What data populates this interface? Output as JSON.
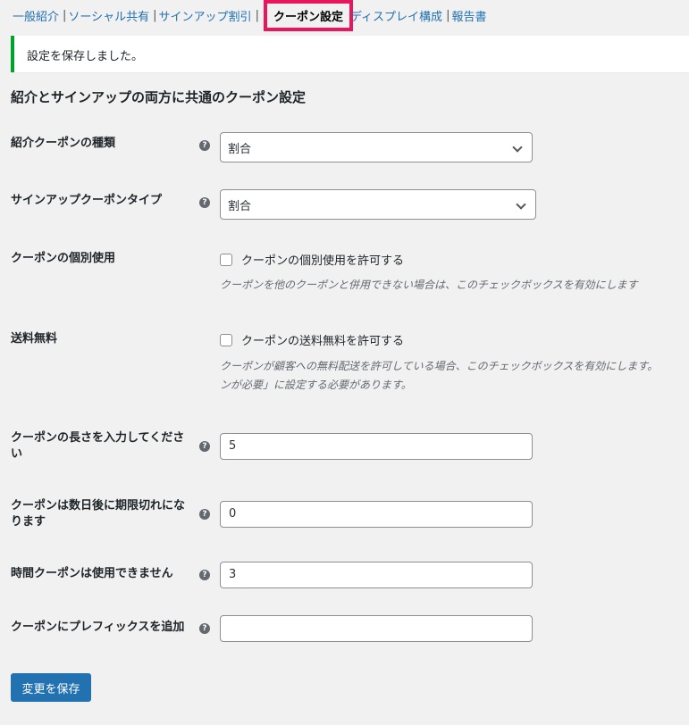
{
  "tabs": [
    {
      "label": "一般紹介"
    },
    {
      "label": "ソーシャル共有"
    },
    {
      "label": "サインアップ割引"
    },
    {
      "label": "クーポン設定"
    },
    {
      "label": "ディスプレイ構成"
    },
    {
      "label": "報告書"
    }
  ],
  "notice": {
    "text": "設定を保存しました。"
  },
  "section_title": "紹介とサインアップの両方に共通のクーポン設定",
  "help_glyph": "?",
  "fields": {
    "referral_coupon_type": {
      "label": "紹介クーポンの種類",
      "value": "割合"
    },
    "signup_coupon_type": {
      "label": "サインアップクーポンタイプ",
      "value": "割合"
    },
    "individual_use": {
      "label": "クーポンの個別使用",
      "checkbox_label": "クーポンの個別使用を許可する",
      "checked": false,
      "description": "クーポンを他のクーポンと併用できない場合は、このチェックボックスを有効にします"
    },
    "free_shipping": {
      "label": "送料無料",
      "checkbox_label": "クーポンの送料無料を許可する",
      "checked": false,
      "description_line1": "クーポンが顧客への無料配送を許可している場合、このチェックボックスを有効にします。",
      "description_line2": "ンが必要」に設定する必要があります。"
    },
    "coupon_length": {
      "label": "クーポンの長さを入力してください",
      "value": "5"
    },
    "expiry_days": {
      "label": "クーポンは数日後に期限切れになります",
      "value": "0"
    },
    "usage_limit": {
      "label": "時間クーポンは使用できません",
      "value": "3"
    },
    "prefix": {
      "label": "クーポンにプレフィックスを追加",
      "value": ""
    }
  },
  "save_label": "変更を保存",
  "colors": {
    "accent": "#2271b1",
    "highlight": "#e8175d",
    "success": "#00a32a"
  }
}
